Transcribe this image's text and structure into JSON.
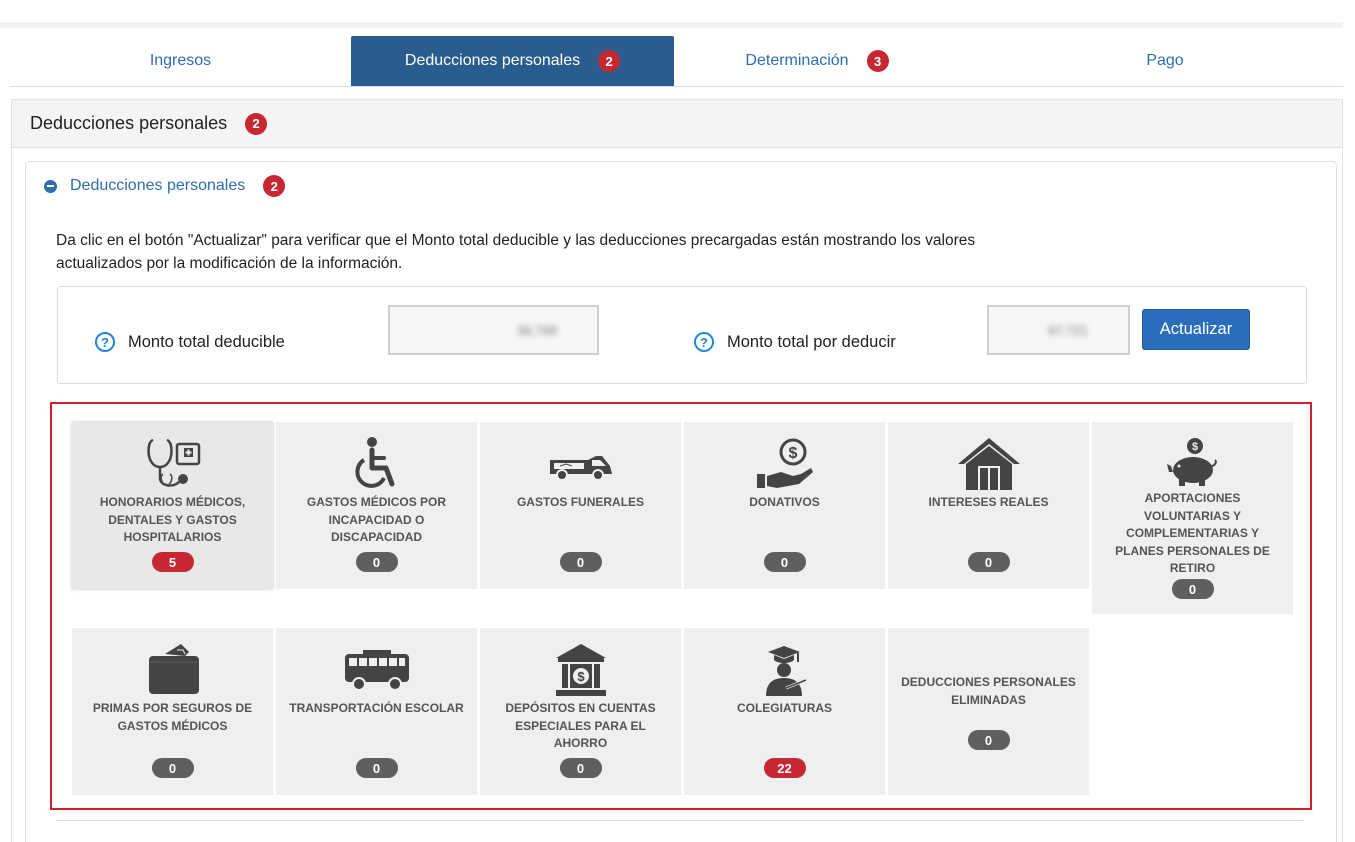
{
  "tabs": [
    {
      "label": "Ingresos",
      "badge": ""
    },
    {
      "label": "Deducciones personales",
      "badge": "2"
    },
    {
      "label": "Determinación",
      "badge": "3"
    },
    {
      "label": "Pago",
      "badge": ""
    }
  ],
  "outer": {
    "title": "Deducciones personales",
    "badge": "2"
  },
  "inner": {
    "title": "Deducciones personales",
    "badge": "2"
  },
  "description": "Da clic en el botón \"Actualizar\" para verificar que el Monto total deducible y las deducciones precargadas están mostrando los valores actualizados por la modificación de la información.",
  "totals": {
    "deducible_label": "Monto total deducible",
    "deducible_value": "36,768",
    "por_deducir_label": "Monto total por deducir",
    "por_deducir_value": "67,721",
    "update_button": "Actualizar"
  },
  "cards": [
    {
      "name": "HONORARIOS MÉDICOS, DENTALES Y GASTOS HOSPITALARIOS",
      "count": "5",
      "icon": "stethoscope-icon"
    },
    {
      "name": "GASTOS MÉDICOS POR INCAPACIDAD O DISCAPACIDAD",
      "count": "0",
      "icon": "wheelchair-icon"
    },
    {
      "name": "GASTOS FUNERALES",
      "count": "0",
      "icon": "hearse-icon"
    },
    {
      "name": "DONATIVOS",
      "count": "0",
      "icon": "donation-icon"
    },
    {
      "name": "INTERESES REALES",
      "count": "0",
      "icon": "house-icon"
    },
    {
      "name": "APORTACIONES VOLUNTARIAS Y COMPLEMENTARIAS Y PLANES PERSONALES DE RETIRO",
      "count": "0",
      "icon": "piggy-bank-icon"
    },
    {
      "name": "PRIMAS POR SEGUROS DE GASTOS MÉDICOS",
      "count": "0",
      "icon": "wallet-icon"
    },
    {
      "name": "TRANSPORTACIÓN ESCOLAR",
      "count": "0",
      "icon": "school-bus-icon"
    },
    {
      "name": "DEPÓSITOS EN CUENTAS ESPECIALES PARA EL AHORRO",
      "count": "0",
      "icon": "bank-icon"
    },
    {
      "name": "COLEGIATURAS",
      "count": "22",
      "icon": "graduate-icon"
    },
    {
      "name": "DEDUCCIONES PERSONALES ELIMINADAS",
      "count": "0",
      "icon": ""
    }
  ],
  "colors": {
    "accent": "#2a5d8e",
    "badge_red": "#c62833",
    "frame_red": "#d31f2a",
    "link_blue": "#2e6eb0"
  }
}
